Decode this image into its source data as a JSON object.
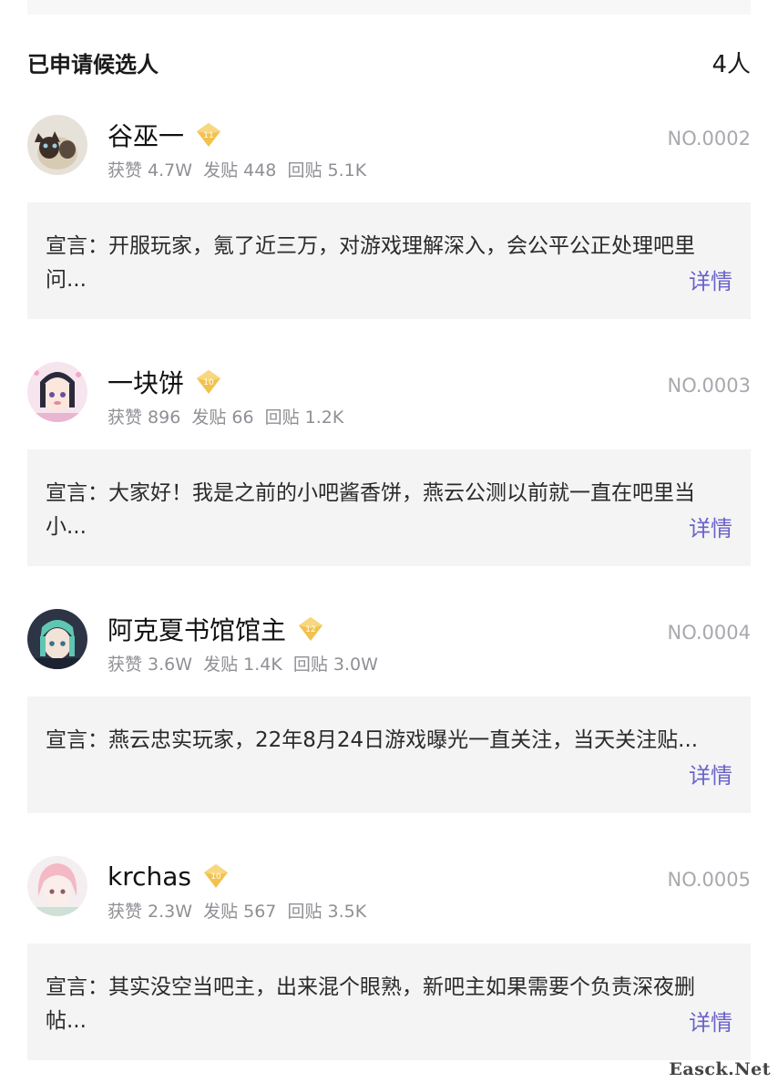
{
  "header": {
    "title": "已申请候选人",
    "count": "4人"
  },
  "candidates": [
    {
      "name": "谷巫一",
      "level": "11",
      "likes": "获赞 4.7W",
      "posts": "发贴 448",
      "replies": "回贴 5.1K",
      "number": "NO.0002",
      "manifesto": "宣言：开服玩家，氪了近三万，对游戏理解深入，会公平公正处理吧里问...",
      "detail": "详情"
    },
    {
      "name": "一块饼",
      "level": "10",
      "likes": "获赞 896",
      "posts": "发贴 66",
      "replies": "回贴 1.2K",
      "number": "NO.0003",
      "manifesto": "宣言：大家好！我是之前的小吧酱香饼，燕云公测以前就一直在吧里当小...",
      "detail": "详情"
    },
    {
      "name": "阿克夏书馆馆主",
      "level": "12",
      "likes": "获赞 3.6W",
      "posts": "发贴 1.4K",
      "replies": "回贴 3.0W",
      "number": "NO.0004",
      "manifesto": "宣言：燕云忠实玩家，22年8月24日游戏曝光一直关注，当天关注贴...",
      "detail": "详情"
    },
    {
      "name": "krchas",
      "level": "10",
      "likes": "获赞 2.3W",
      "posts": "发贴 567",
      "replies": "回贴 3.5K",
      "number": "NO.0005",
      "manifesto": "宣言：其实没空当吧主，出来混个眼熟，新吧主如果需要个负责深夜删帖...",
      "detail": "详情"
    }
  ],
  "watermark": "Easck.Net",
  "colors": {
    "badge": "#f2c14e",
    "link": "#6a62c8",
    "card": "#f4f4f5"
  }
}
